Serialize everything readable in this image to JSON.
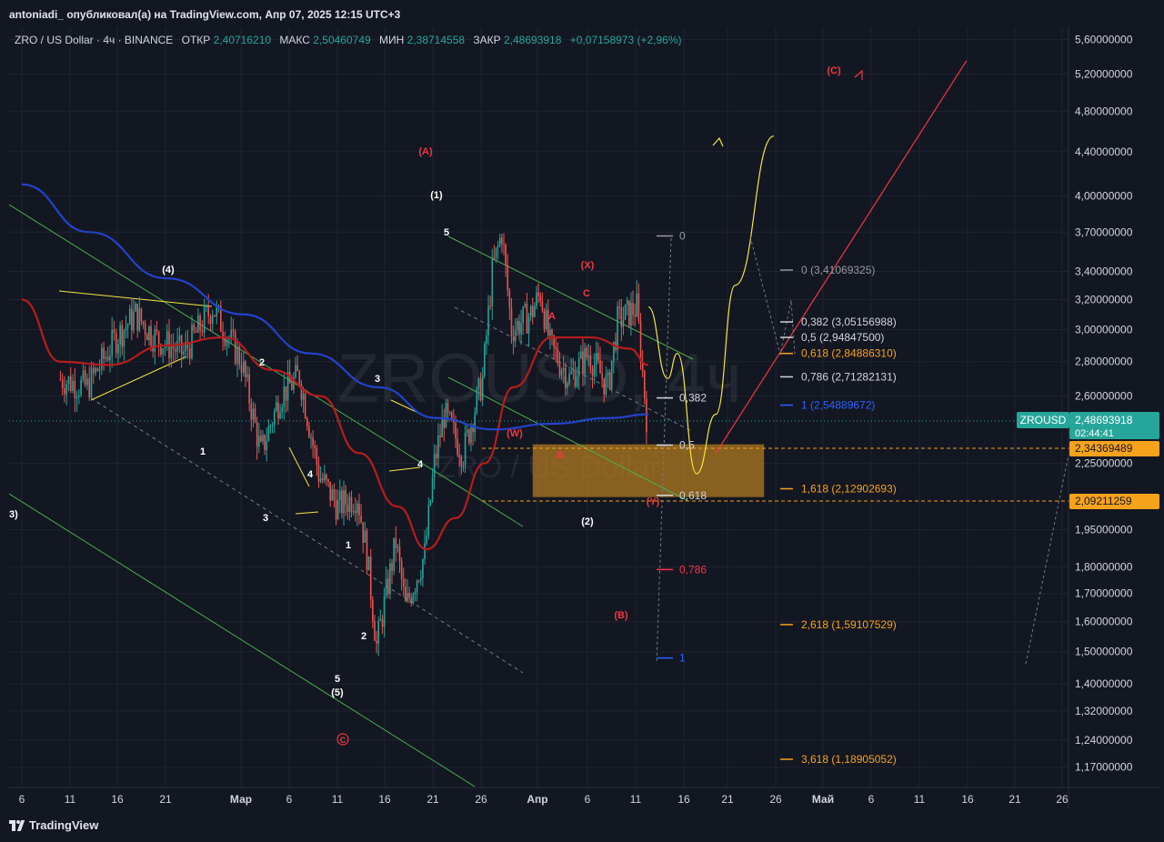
{
  "header": {
    "published": "antoniadi_ опубликовал(а) на TradingView.com, Апр 07, 2025 12:15 UTC+3"
  },
  "legend": {
    "symbol": "ZRO / US Dollar · 4ч · BINANCE",
    "open_label": "ОТКР",
    "open": "2,40716210",
    "high_label": "МАКС",
    "high": "2,50460749",
    "low_label": "МИН",
    "low": "2,38714558",
    "close_label": "ЗАКР",
    "close": "2,48693918",
    "change": "+0,07158973 (+2,96%)"
  },
  "watermark": {
    "main": "ZROUSD, 4ч",
    "sub": "ZRO / US Dollar"
  },
  "price_axis": {
    "ticks": [
      {
        "label": "5,60000000",
        "v": 5.6
      },
      {
        "label": "5,20000000",
        "v": 5.2
      },
      {
        "label": "4,80000000",
        "v": 4.8
      },
      {
        "label": "4,40000000",
        "v": 4.4
      },
      {
        "label": "4,00000000",
        "v": 4.0
      },
      {
        "label": "3,70000000",
        "v": 3.7
      },
      {
        "label": "3,40000000",
        "v": 3.4
      },
      {
        "label": "3,20000000",
        "v": 3.2
      },
      {
        "label": "3,00000000",
        "v": 3.0
      },
      {
        "label": "2,80000000",
        "v": 2.8
      },
      {
        "label": "2,60000000",
        "v": 2.6
      },
      {
        "label": "2,25000000",
        "v": 2.25
      },
      {
        "label": "1,95000000",
        "v": 1.95
      },
      {
        "label": "1,80000000",
        "v": 1.8
      },
      {
        "label": "1,70000000",
        "v": 1.7
      },
      {
        "label": "1,60000000",
        "v": 1.6
      },
      {
        "label": "1,50000000",
        "v": 1.5
      },
      {
        "label": "1,40000000",
        "v": 1.4
      },
      {
        "label": "1,32000000",
        "v": 1.32
      },
      {
        "label": "1,24000000",
        "v": 1.24
      },
      {
        "label": "1,17000000",
        "v": 1.17
      }
    ],
    "current_symbol": "ZROUSD",
    "current_price": "2,48693918",
    "countdown": "02:44:41",
    "level_1": "2,34369489",
    "level_2": "2,09211259"
  },
  "time_axis": [
    "6",
    "11",
    "16",
    "21",
    "Мар",
    "6",
    "11",
    "16",
    "21",
    "26",
    "Апр",
    "6",
    "11",
    "16",
    "21",
    "26",
    "Май",
    "6",
    "11",
    "16",
    "21",
    "26"
  ],
  "fib_levels": [
    {
      "label": "0 (3,41069325)",
      "v": 3.41,
      "color": "#9598a1"
    },
    {
      "label": "0,382 (3,05156988)",
      "v": 3.05,
      "color": "#d1d4dc"
    },
    {
      "label": "0,5 (2,94847500)",
      "v": 2.95,
      "color": "#d1d4dc"
    },
    {
      "label": "0,618 (2,84886310)",
      "v": 2.85,
      "color": "#f7a21b"
    },
    {
      "label": "0,786 (2,71282131)",
      "v": 2.71,
      "color": "#d1d4dc"
    },
    {
      "label": "1 (2,54889672)",
      "v": 2.55,
      "color": "#2962ff"
    },
    {
      "label": "1,618 (2,12902693)",
      "v": 2.13,
      "color": "#f7a21b"
    },
    {
      "label": "2,618 (1,59107529)",
      "v": 1.59,
      "color": "#f7a21b"
    },
    {
      "label": "3,618 (1,18905052)",
      "v": 1.19,
      "color": "#f7a21b"
    }
  ],
  "retrace_levels": [
    {
      "label": "0",
      "v": 3.67,
      "color": "#9598a1"
    },
    {
      "label": "0,382",
      "v": 2.59,
      "color": "#d1d4dc"
    },
    {
      "label": "0,5",
      "v": 2.34,
      "color": "#d1d4dc"
    },
    {
      "label": "0,618",
      "v": 2.1,
      "color": "#d1d4dc"
    },
    {
      "label": "0,786",
      "v": 1.79,
      "color": "#f23645"
    },
    {
      "label": "1",
      "v": 1.48,
      "color": "#2962ff"
    }
  ],
  "wave_labels": {
    "white": [
      "(4)",
      "2",
      "1",
      "3",
      "4",
      "3",
      "(1)",
      "5",
      "1",
      "2",
      "5",
      "(5)",
      "4",
      "(2)"
    ],
    "red": [
      "(A)",
      "(X)",
      "C",
      "A",
      "(W)",
      "B",
      "(Y)",
      "(B)",
      "(C)",
      "C"
    ],
    "edge": "3)"
  },
  "brand": "TradingView",
  "colors": {
    "background": "#131722",
    "up": "#26a69a",
    "down": "#ef5350",
    "ma_red": "#b71c1c",
    "ma_blue": "#2342c9",
    "channel": "#4caf50",
    "projection_yellow": "#f5e642",
    "projection_red": "#f23645",
    "zone": "#b07a1f",
    "accent": "#f7a21b"
  },
  "chart_data": {
    "type": "candlestick",
    "symbol": "ZRO / US Dollar",
    "interval": "4ч",
    "yscale": "log",
    "ylim": [
      1.12,
      5.75
    ],
    "series": [
      {
        "date": "2025-02-05",
        "v": 2.7
      },
      {
        "date": "2025-02-08",
        "v": 2.65
      },
      {
        "date": "2025-02-11",
        "v": 2.95
      },
      {
        "date": "2025-02-13",
        "v": 3.1
      },
      {
        "date": "2025-02-15",
        "v": 2.95
      },
      {
        "date": "2025-02-18",
        "v": 2.85
      },
      {
        "date": "2025-02-21",
        "v": 3.15
      },
      {
        "date": "2025-02-24",
        "v": 2.8
      },
      {
        "date": "2025-02-26",
        "v": 2.3
      },
      {
        "date": "2025-02-28",
        "v": 2.6
      },
      {
        "date": "2025-03-02",
        "v": 2.72
      },
      {
        "date": "2025-03-04",
        "v": 2.2
      },
      {
        "date": "2025-03-06",
        "v": 2.05
      },
      {
        "date": "2025-03-08",
        "v": 2.1
      },
      {
        "date": "2025-03-09",
        "v": 1.85
      },
      {
        "date": "2025-03-10",
        "v": 1.52
      },
      {
        "date": "2025-03-12",
        "v": 1.9
      },
      {
        "date": "2025-03-13",
        "v": 1.65
      },
      {
        "date": "2025-03-15",
        "v": 1.85
      },
      {
        "date": "2025-03-16",
        "v": 2.25
      },
      {
        "date": "2025-03-17",
        "v": 2.5
      },
      {
        "date": "2025-03-19",
        "v": 2.3
      },
      {
        "date": "2025-03-21",
        "v": 2.7
      },
      {
        "date": "2025-03-22",
        "v": 3.4
      },
      {
        "date": "2025-03-23",
        "v": 3.7
      },
      {
        "date": "2025-03-24",
        "v": 3.0
      },
      {
        "date": "2025-03-26",
        "v": 3.1
      },
      {
        "date": "2025-03-27",
        "v": 3.25
      },
      {
        "date": "2025-03-28",
        "v": 2.9
      },
      {
        "date": "2025-03-30",
        "v": 2.7
      },
      {
        "date": "2025-04-01",
        "v": 2.85
      },
      {
        "date": "2025-04-03",
        "v": 2.65
      },
      {
        "date": "2025-04-04",
        "v": 3.05
      },
      {
        "date": "2025-04-06",
        "v": 3.15
      },
      {
        "date": "2025-04-07",
        "v": 2.49
      }
    ],
    "ma_red": [
      {
        "date": "2025-02-01",
        "v": 3.2
      },
      {
        "date": "2025-02-05",
        "v": 2.8
      },
      {
        "date": "2025-02-10",
        "v": 2.78
      },
      {
        "date": "2025-02-16",
        "v": 2.9
      },
      {
        "date": "2025-02-22",
        "v": 2.95
      },
      {
        "date": "2025-02-27",
        "v": 2.75
      },
      {
        "date": "2025-03-04",
        "v": 2.6
      },
      {
        "date": "2025-03-08",
        "v": 2.3
      },
      {
        "date": "2025-03-12",
        "v": 2.05
      },
      {
        "date": "2025-03-15",
        "v": 1.87
      },
      {
        "date": "2025-03-18",
        "v": 2.0
      },
      {
        "date": "2025-03-21",
        "v": 2.25
      },
      {
        "date": "2025-03-24",
        "v": 2.65
      },
      {
        "date": "2025-03-28",
        "v": 2.95
      },
      {
        "date": "2025-04-01",
        "v": 2.95
      },
      {
        "date": "2025-04-05",
        "v": 2.88
      },
      {
        "date": "2025-04-07",
        "v": 2.78
      }
    ],
    "ma_blue": [
      {
        "date": "2025-02-01",
        "v": 4.1
      },
      {
        "date": "2025-02-08",
        "v": 3.7
      },
      {
        "date": "2025-02-16",
        "v": 3.35
      },
      {
        "date": "2025-02-24",
        "v": 3.1
      },
      {
        "date": "2025-03-03",
        "v": 2.85
      },
      {
        "date": "2025-03-10",
        "v": 2.65
      },
      {
        "date": "2025-03-16",
        "v": 2.48
      },
      {
        "date": "2025-03-22",
        "v": 2.42
      },
      {
        "date": "2025-03-28",
        "v": 2.45
      },
      {
        "date": "2025-04-03",
        "v": 2.48
      },
      {
        "date": "2025-04-07",
        "v": 2.5
      }
    ],
    "projection_yellow": [
      {
        "date": "2025-04-07",
        "v": 3.15
      },
      {
        "date": "2025-04-09",
        "v": 2.7
      },
      {
        "date": "2025-04-10",
        "v": 2.85
      },
      {
        "date": "2025-04-12",
        "v": 2.2
      },
      {
        "date": "2025-04-14",
        "v": 2.5
      },
      {
        "date": "2025-04-16",
        "v": 3.3
      },
      {
        "date": "2025-04-20",
        "v": 4.55
      }
    ],
    "projection_red": [
      {
        "date": "2025-04-14",
        "v": 2.3
      },
      {
        "date": "2025-05-10",
        "v": 5.35
      }
    ],
    "zone": {
      "from": "2025-03-26",
      "to": "2025-04-19",
      "top": 2.3437,
      "bottom": 2.0921
    }
  }
}
